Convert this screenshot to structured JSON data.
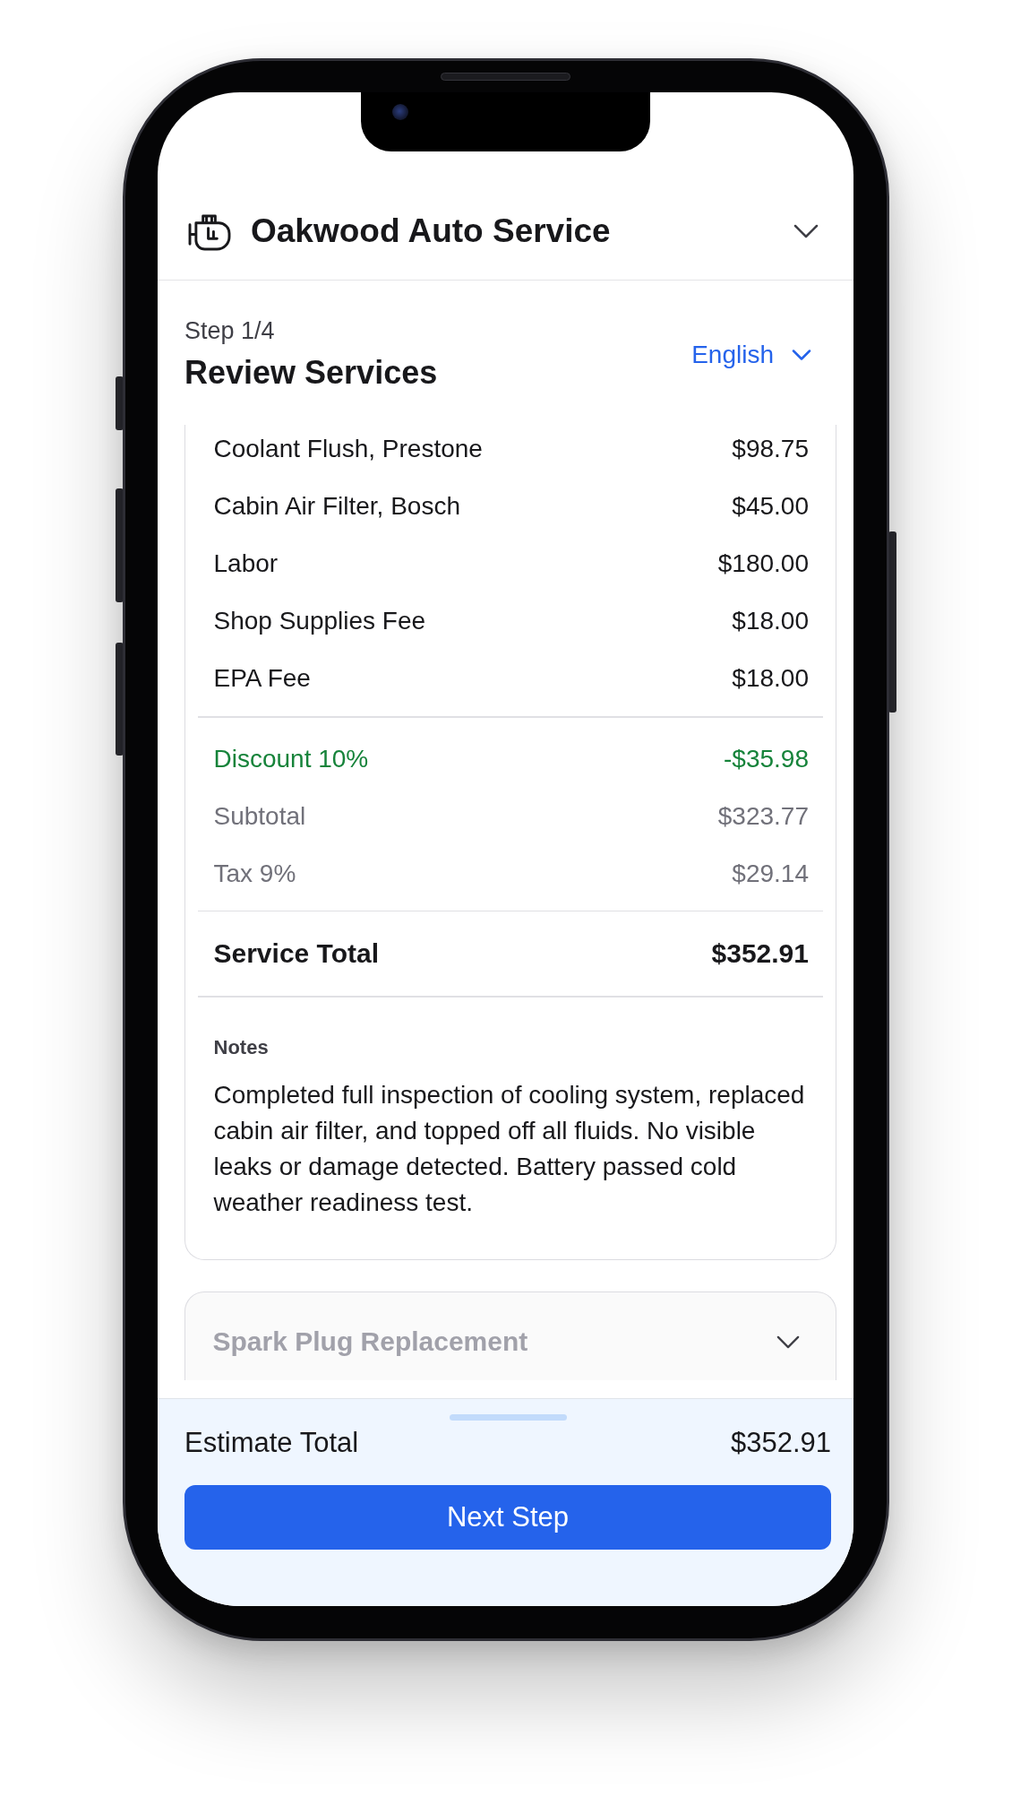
{
  "header": {
    "business_name": "Oakwood Auto Service"
  },
  "step": {
    "label": "Step 1/4",
    "title": "Review Services",
    "language": "English"
  },
  "services": [
    {
      "expanded": true,
      "line_items": [
        {
          "name": "Coolant Flush, Prestone",
          "price": "$98.75"
        },
        {
          "name": "Cabin Air Filter, Bosch",
          "price": "$45.00"
        },
        {
          "name": "Labor",
          "price": "$180.00"
        },
        {
          "name": "Shop Supplies Fee",
          "price": "$18.00"
        },
        {
          "name": "EPA Fee",
          "price": "$18.00"
        }
      ],
      "adjustments": [
        {
          "kind": "discount",
          "label": "Discount 10%",
          "amount": "-$35.98"
        },
        {
          "kind": "subtotal",
          "label": "Subtotal",
          "amount": "$323.77"
        },
        {
          "kind": "tax",
          "label": "Tax 9%",
          "amount": "$29.14"
        }
      ],
      "total": {
        "label": "Service Total",
        "amount": "$352.91"
      },
      "notes": {
        "label": "Notes",
        "text": "Completed full inspection of cooling system, replaced cabin air filter, and topped off all fluids. No visible leaks or damage detected. Battery passed cold weather readiness test."
      }
    },
    {
      "title": "Spark Plug Replacement",
      "expanded": false
    }
  ],
  "footer": {
    "label": "Estimate Total",
    "amount": "$352.91",
    "button": "Next Step"
  }
}
